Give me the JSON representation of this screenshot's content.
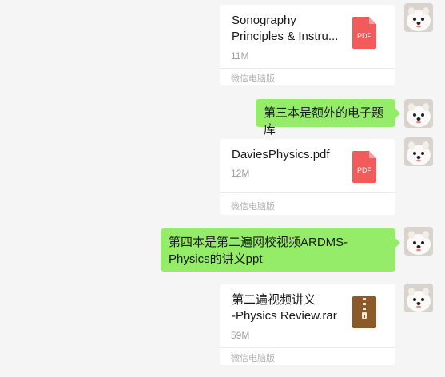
{
  "messages": [
    {
      "type": "file",
      "name": "Sonography\nPrinciples & Instru...",
      "size": "11M",
      "source": "微信电脑版",
      "icon": "pdf-file-icon",
      "icon_label": "PDF"
    },
    {
      "type": "text",
      "text": "第三本是额外的电子题库"
    },
    {
      "type": "file",
      "name": "DaviesPhysics.pdf",
      "size": "12M",
      "source": "微信电脑版",
      "icon": "pdf-file-icon",
      "icon_label": "PDF"
    },
    {
      "type": "text",
      "text": "第四本是第二遍网校视频ARDMS-Physics的讲义ppt"
    },
    {
      "type": "file",
      "name": "第二遍视频讲义\n-Physics Review.rar",
      "size": "59M",
      "source": "微信电脑版",
      "icon": "rar-archive-icon"
    }
  ],
  "colors": {
    "background": "#f5f5f5",
    "bubble": "#95ec69",
    "pdf_icon": "#f15b5b",
    "rar_icon": "#8b5a2b"
  }
}
